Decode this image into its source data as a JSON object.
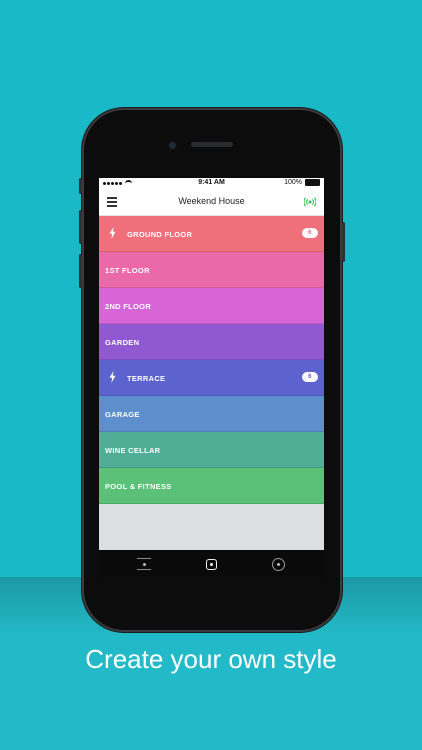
{
  "status_bar": {
    "time": "9:41 AM",
    "battery": "100%"
  },
  "nav": {
    "title": "Weekend House",
    "menu_icon": "hamburger-icon",
    "right_icon": "signal-icon"
  },
  "rooms": [
    {
      "label": "GROUND FLOOR",
      "color": "#ef6f7b",
      "icon": "bolt-icon",
      "badge": "6",
      "badge_color": "#ef6f7b"
    },
    {
      "label": "1ST FLOOR",
      "color": "#ea69a8"
    },
    {
      "label": "2ND FLOOR",
      "color": "#d865d8"
    },
    {
      "label": "GARDEN",
      "color": "#9059d1"
    },
    {
      "label": "TERRACE",
      "color": "#5c63cf",
      "icon": "bolt-icon",
      "badge": "6",
      "badge_color": "#5c63cf"
    },
    {
      "label": "GARAGE",
      "color": "#5e8fcd"
    },
    {
      "label": "WINE CELLAR",
      "color": "#4fae95"
    },
    {
      "label": "POOL & FITNESS",
      "color": "#5bc078"
    }
  ],
  "tab_bar": {
    "items": [
      "list-tab-icon",
      "home-tab-icon",
      "circle-tab-icon"
    ]
  },
  "caption": "Create your own style",
  "colors": {
    "background": "#19b9c7",
    "accent": "#3ec35a"
  }
}
